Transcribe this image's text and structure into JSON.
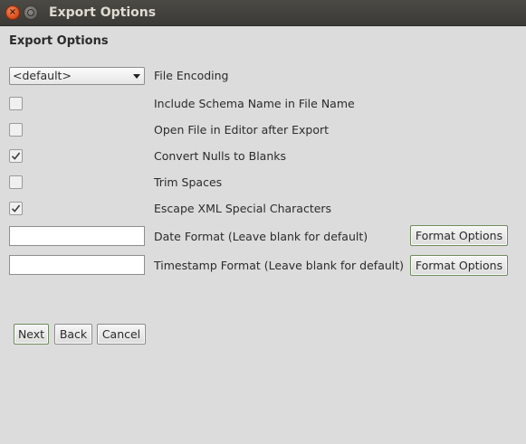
{
  "window": {
    "title": "Export Options"
  },
  "heading": "Export Options",
  "encoding": {
    "selected": "<default>",
    "label": "File Encoding"
  },
  "options": [
    {
      "label": "Include Schema Name in File Name",
      "checked": false
    },
    {
      "label": "Open File in Editor after Export",
      "checked": false
    },
    {
      "label": "Convert Nulls to Blanks",
      "checked": true
    },
    {
      "label": "Trim Spaces",
      "checked": false
    },
    {
      "label": "Escape XML Special Characters",
      "checked": true
    }
  ],
  "date_format": {
    "value": "",
    "label": "Date Format (Leave blank for default)",
    "button": "Format Options"
  },
  "timestamp_format": {
    "value": "",
    "label": "Timestamp Format (Leave blank for default)",
    "button": "Format Options"
  },
  "buttons": {
    "next": "Next",
    "back": "Back",
    "cancel": "Cancel"
  }
}
